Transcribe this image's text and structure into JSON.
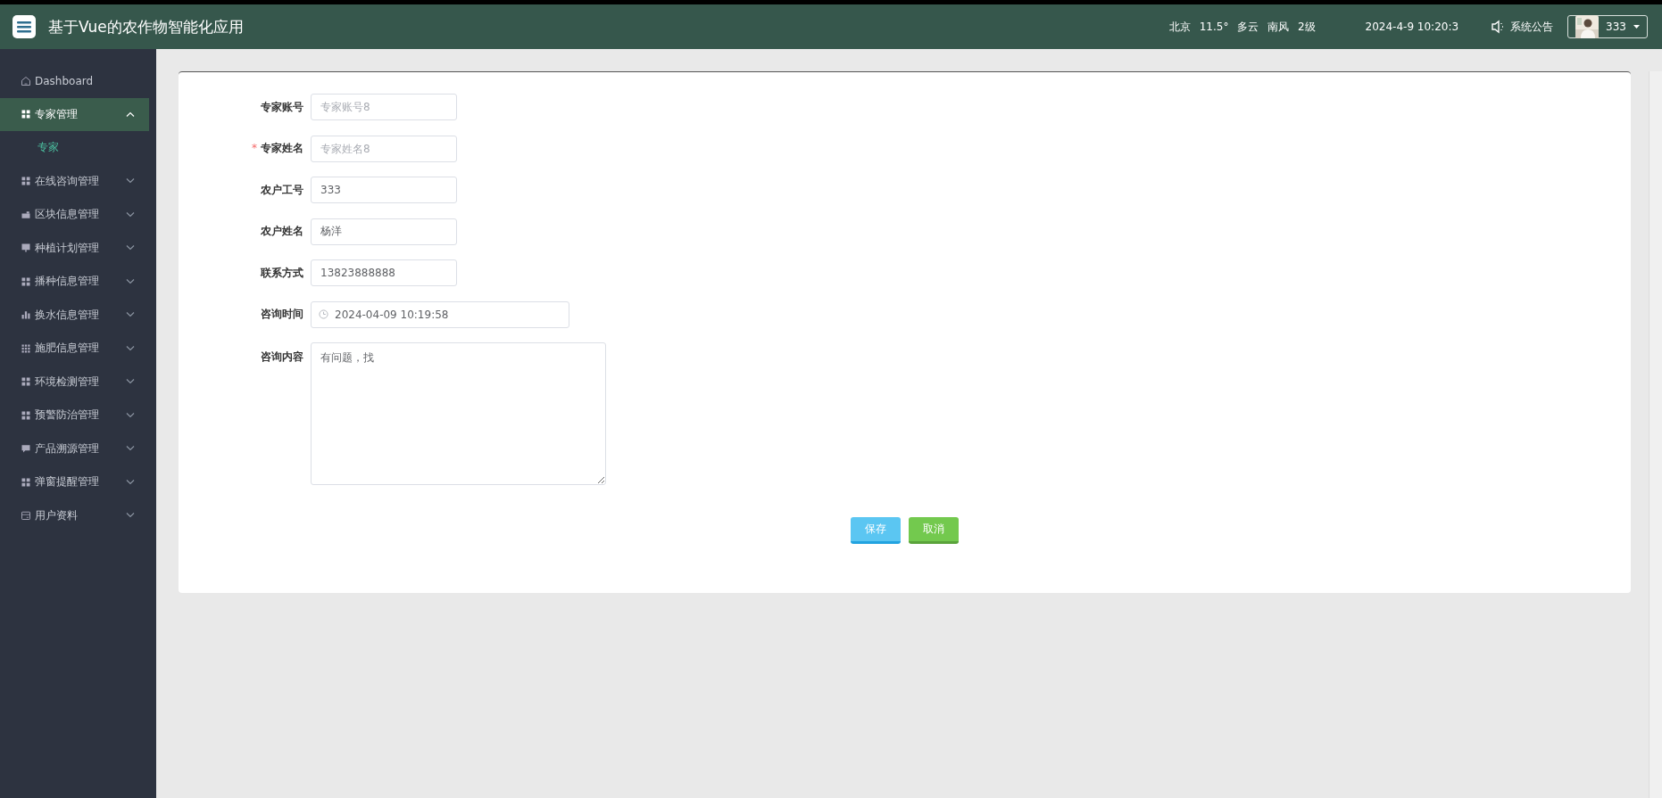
{
  "header": {
    "title": "基于Vue的农作物智能化应用",
    "weather": "北京 11.5° 多云 南风 2级",
    "datetime": "2024-4-9 10:20:3",
    "notice": "系统公告",
    "user": {
      "name": "333"
    }
  },
  "sidebar": {
    "items": [
      {
        "kind": "link",
        "label": "Dashboard",
        "selected": false
      },
      {
        "kind": "menu",
        "label": "专家管理",
        "selected": true,
        "expanded": true,
        "children": [
          {
            "label": "专家",
            "selected": true
          }
        ]
      },
      {
        "kind": "menu",
        "label": "在线咨询管理",
        "selected": false,
        "expanded": false
      },
      {
        "kind": "menu",
        "label": "区块信息管理",
        "selected": false,
        "expanded": false
      },
      {
        "kind": "menu",
        "label": "种植计划管理",
        "selected": false,
        "expanded": false
      },
      {
        "kind": "menu",
        "label": "播种信息管理",
        "selected": false,
        "expanded": false
      },
      {
        "kind": "menu",
        "label": "换水信息管理",
        "selected": false,
        "expanded": false
      },
      {
        "kind": "menu",
        "label": "施肥信息管理",
        "selected": false,
        "expanded": false
      },
      {
        "kind": "menu",
        "label": "环境检测管理",
        "selected": false,
        "expanded": false
      },
      {
        "kind": "menu",
        "label": "预警防治管理",
        "selected": false,
        "expanded": false
      },
      {
        "kind": "menu",
        "label": "产品溯源管理",
        "selected": false,
        "expanded": false
      },
      {
        "kind": "menu",
        "label": "弹窗提醒管理",
        "selected": false,
        "expanded": false
      },
      {
        "kind": "menu",
        "label": "用户资料",
        "selected": false,
        "expanded": false
      }
    ]
  },
  "form": {
    "fields": [
      {
        "kind": "text",
        "label": "专家账号",
        "placeholder": "专家账号8"
      },
      {
        "kind": "text",
        "label": "专家姓名",
        "required_mark": "*",
        "placeholder": "专家姓名8"
      },
      {
        "kind": "text",
        "label": "农户工号",
        "value": "333"
      },
      {
        "kind": "text",
        "label": "农户姓名",
        "value": "杨洋"
      },
      {
        "kind": "text",
        "label": "联系方式",
        "value": "13823888888"
      },
      {
        "kind": "datetime",
        "label": "咨询时间",
        "value": "2024-04-09 10:19:58"
      },
      {
        "kind": "textarea",
        "label": "咨询内容",
        "value": "有问题，找"
      }
    ],
    "buttons": [
      {
        "kind": "primary",
        "label": "保存"
      },
      {
        "kind": "success",
        "label": "取消"
      }
    ]
  }
}
